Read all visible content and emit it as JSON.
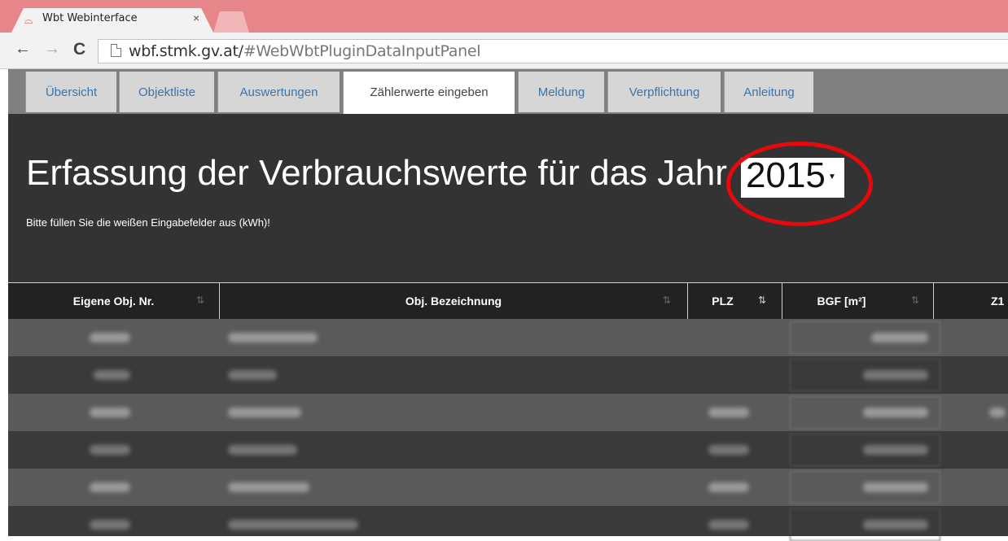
{
  "browser": {
    "tab_title": "Wbt Webinterface",
    "tab_close": "×",
    "url_host": "wbf.stmk.gv.at/",
    "url_path": "#WebWbtPluginDataInputPanel"
  },
  "nav_tabs": [
    {
      "label": "Übersicht",
      "active": false
    },
    {
      "label": "Objektliste",
      "active": false
    },
    {
      "label": "Auswertungen",
      "active": false
    },
    {
      "label": "Zählerwerte eingeben",
      "active": true
    },
    {
      "label": "Meldung",
      "active": false
    },
    {
      "label": "Verpflichtung",
      "active": false
    },
    {
      "label": "Anleitung",
      "active": false
    }
  ],
  "main": {
    "heading": "Erfassung der Verbrauchswerte für das Jahr",
    "year": "2015",
    "subtitle": "Bitte füllen Sie die weißen Eingabefelder aus (kWh)!"
  },
  "table": {
    "columns": [
      "Eigene Obj. Nr.",
      "Obj. Bezeichnung",
      "PLZ",
      "BGF [m²]",
      "Z1"
    ],
    "sorted_column": "PLZ",
    "rows_blurred": 6
  },
  "colors": {
    "tab_strip": "#e6868a",
    "content_bg": "#333333",
    "highlight_circle": "#e8090c",
    "link_blue": "#3b74a7"
  }
}
